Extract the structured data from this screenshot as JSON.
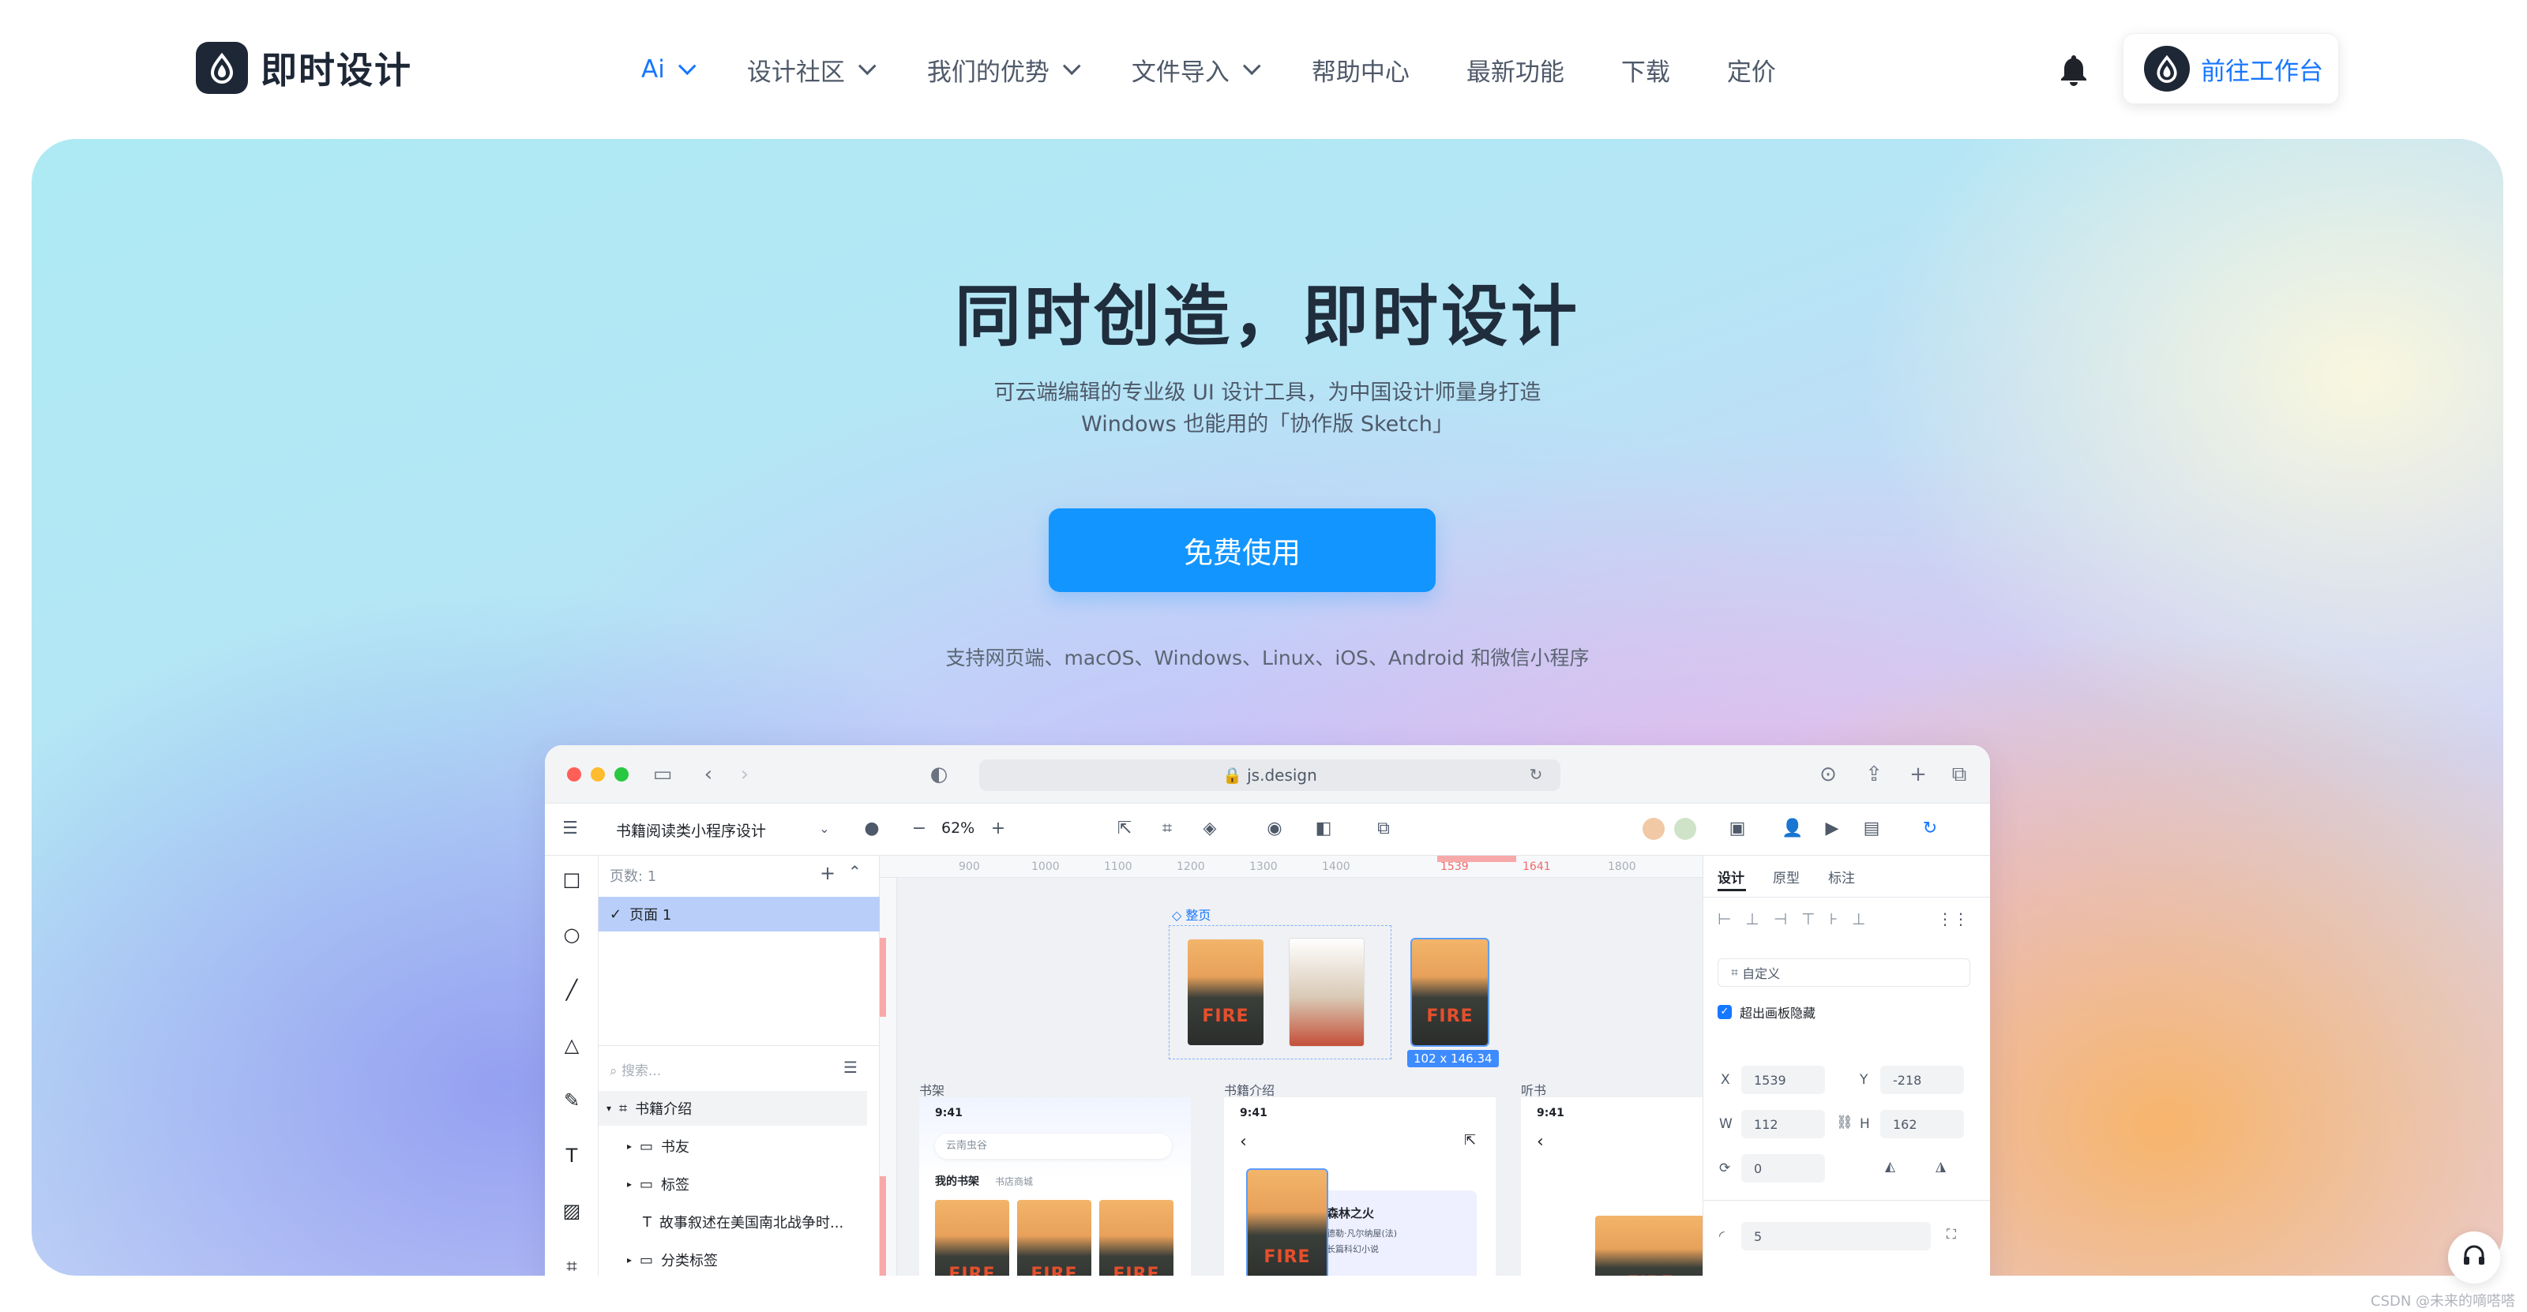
{
  "brand": {
    "name": "即时设计"
  },
  "nav": {
    "items": [
      {
        "label": "Ai",
        "has_dropdown": true,
        "active": true
      },
      {
        "label": "设计社区",
        "has_dropdown": true
      },
      {
        "label": "我们的优势",
        "has_dropdown": true
      },
      {
        "label": "文件导入",
        "has_dropdown": true
      },
      {
        "label": "帮助中心",
        "has_dropdown": false
      },
      {
        "label": "最新功能",
        "has_dropdown": false
      },
      {
        "label": "下载",
        "has_dropdown": false
      },
      {
        "label": "定价",
        "has_dropdown": false
      }
    ],
    "bell_icon": "bell-icon",
    "workbench_label": "前往工作台"
  },
  "hero": {
    "title": "同时创造，即时设计",
    "subtitle_line1": "可云端编辑的专业级 UI 设计工具，为中国设计师量身打造",
    "subtitle_line2": "Windows 也能用的「协作版 Sketch」",
    "cta_label": "免费使用",
    "platforms": "支持网页端、macOS、Windows、Linux、iOS、Android 和微信小程序"
  },
  "app": {
    "url": "js.design",
    "project_name": "书籍阅读类小程序设计",
    "zoom": "62%",
    "pages_header": "页数: 1",
    "current_page": "页面 1",
    "search_placeholder": "搜索...",
    "layers": [
      {
        "label": "书籍介绍",
        "depth": 0,
        "icon": "frame-icon"
      },
      {
        "label": "书友",
        "depth": 1,
        "icon": "folder-icon"
      },
      {
        "label": "标签",
        "depth": 1,
        "icon": "folder-icon"
      },
      {
        "label": "故事叙述在美国南北战争时...",
        "depth": 1,
        "icon": "text-icon"
      },
      {
        "label": "分类标签",
        "depth": 1,
        "icon": "folder-icon"
      }
    ],
    "ruler_ticks": [
      "900",
      "1000",
      "1100",
      "1200",
      "1300",
      "1400",
      "1539",
      "1641",
      "1800"
    ],
    "canvas": {
      "group_label": "整页",
      "selection_size": "102 x 146.34",
      "frames": [
        "书架",
        "书籍介绍",
        "听书"
      ],
      "phone_time": "9:41",
      "search_text": "云南虫谷",
      "tab_mine": "我的书架",
      "tab_store": "书店商城",
      "book_title": "森林之火",
      "book_author": "德勒·凡尔纳屋(法)",
      "book_tag": "长篇科幻小说"
    },
    "props": {
      "tabs": [
        "设计",
        "原型",
        "标注"
      ],
      "frame_preset": "自定义",
      "clip_label": "超出画板隐藏",
      "x_label": "X",
      "x_value": "1539",
      "y_label": "Y",
      "y_value": "-218",
      "w_label": "W",
      "w_value": "112",
      "h_label": "H",
      "h_value": "162",
      "rotation": "0",
      "radius": "5"
    }
  },
  "watermark": "CSDN @未来的嘀嗒嗒",
  "colors": {
    "primary": "#1295ff",
    "accent": "#1677ff",
    "dark": "#1e2736"
  }
}
